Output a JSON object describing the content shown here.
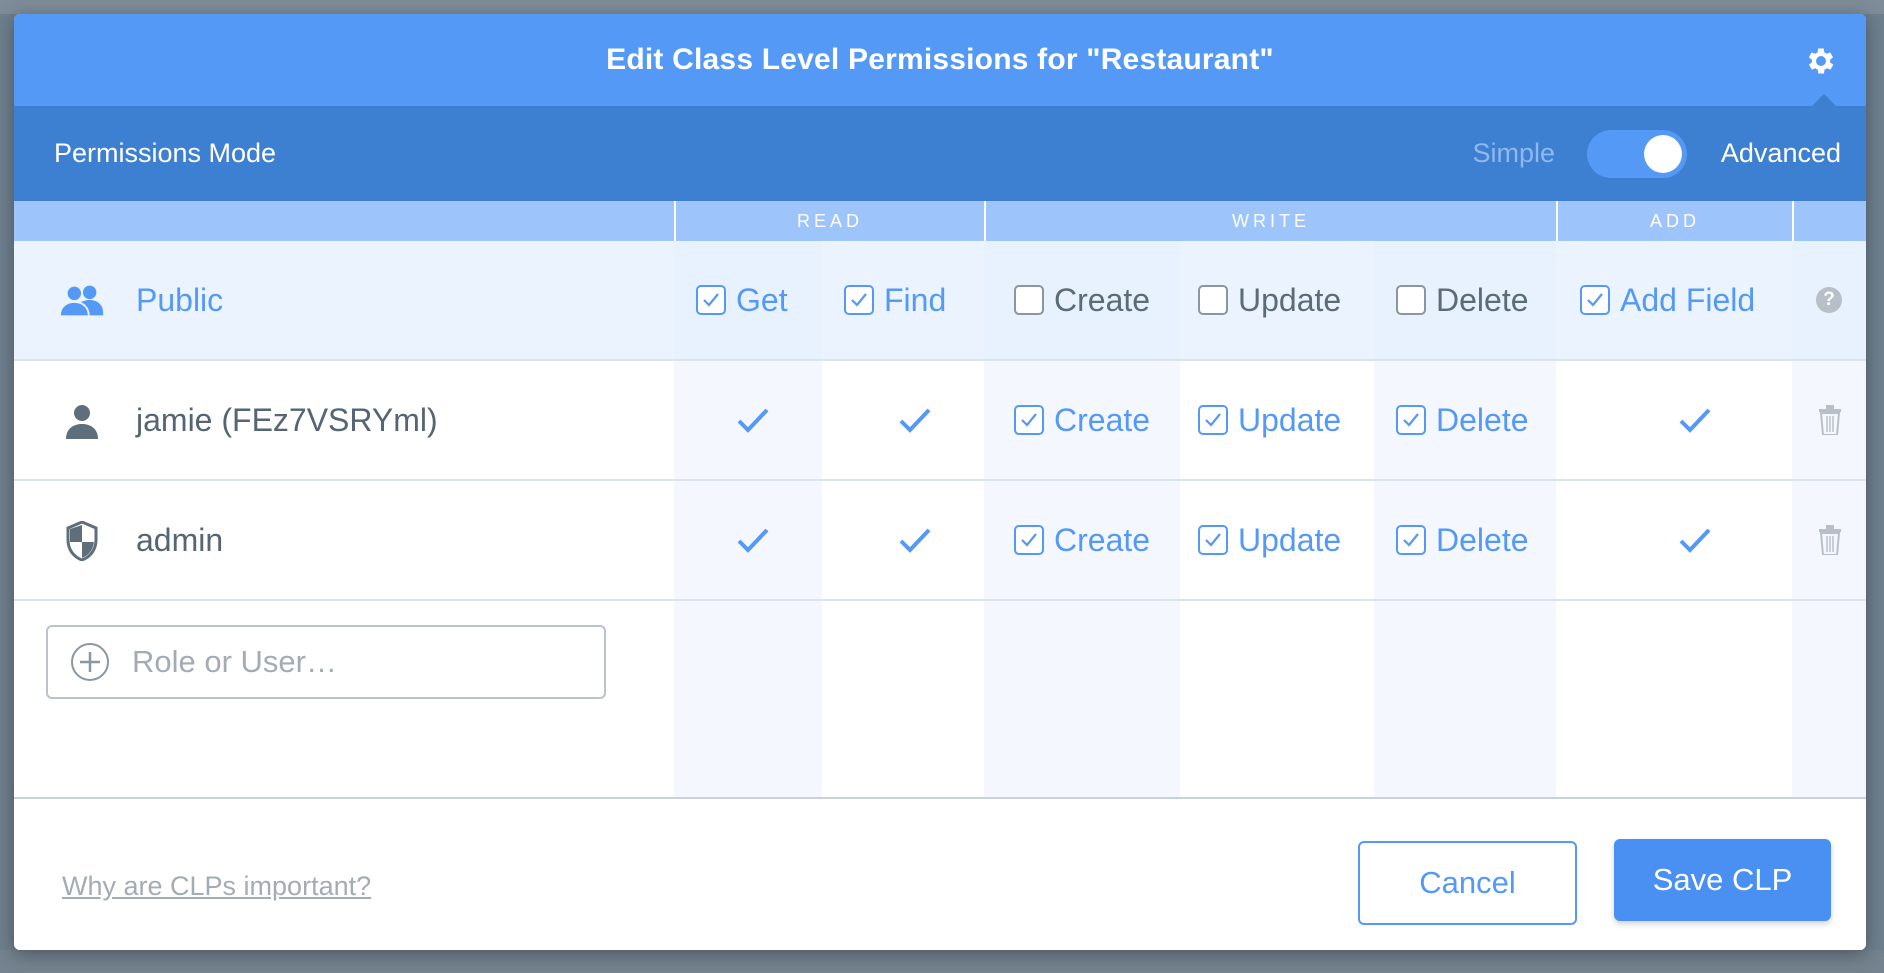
{
  "modal": {
    "title": "Edit Class Level Permissions for \"Restaurant\""
  },
  "mode_bar": {
    "label": "Permissions Mode",
    "simple_label": "Simple",
    "advanced_label": "Advanced",
    "advanced_enabled": true
  },
  "groups": {
    "read": "READ",
    "write": "WRITE",
    "add": "ADD"
  },
  "rows": {
    "public": {
      "name": "Public",
      "get": "Get",
      "find": "Find",
      "create": "Create",
      "update": "Update",
      "delete": "Delete",
      "add_field": "Add Field",
      "help": "?"
    },
    "jamie": {
      "name": "jamie (FEz7VSRYml)",
      "create": "Create",
      "update": "Update",
      "delete": "Delete"
    },
    "admin": {
      "name": "admin",
      "create": "Create",
      "update": "Update",
      "delete": "Delete"
    }
  },
  "add_entry": {
    "placeholder": "Role or User…"
  },
  "footer": {
    "why_link": "Why are CLPs important?",
    "cancel_label": "Cancel",
    "save_label": "Save CLP"
  },
  "colors": {
    "accent": "#5599f6",
    "header_dark": "#3d7fd1",
    "group_header": "#9ec5fb"
  }
}
